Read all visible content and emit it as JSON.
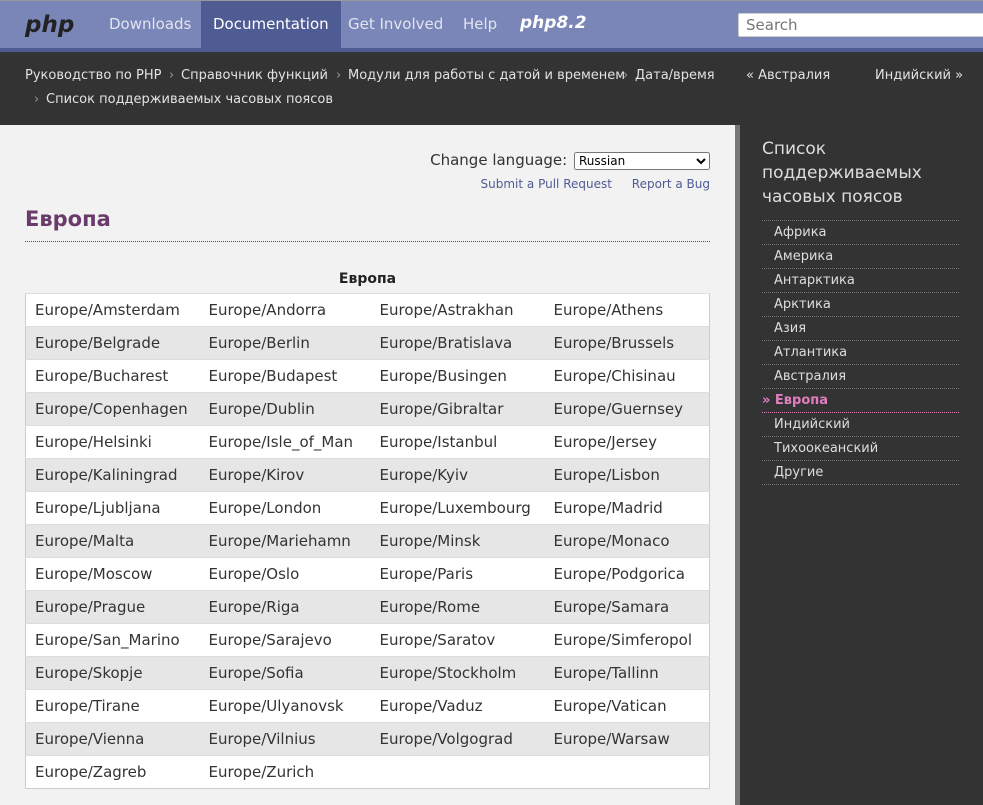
{
  "nav": {
    "logo": "php",
    "items": [
      "Downloads",
      "Documentation",
      "Get Involved",
      "Help"
    ],
    "active": "Documentation",
    "version_logo": "php8.2",
    "search_placeholder": "Search"
  },
  "breadcrumbs": [
    "Руководство по PHP",
    "Справочник функций",
    "Модули для работы с датой и временем",
    "Дата/время",
    "Список поддерживаемых часовых поясов"
  ],
  "prev_link": "« Австралия",
  "next_link": "Индийский »",
  "lang": {
    "label": "Change language:",
    "selected": "Russian"
  },
  "links": {
    "pull": "Submit a Pull Request",
    "bug": "Report a Bug"
  },
  "title": "Европа",
  "table": {
    "caption": "Европа",
    "rows": [
      [
        "Europe/Amsterdam",
        "Europe/Andorra",
        "Europe/Astrakhan",
        "Europe/Athens"
      ],
      [
        "Europe/Belgrade",
        "Europe/Berlin",
        "Europe/Bratislava",
        "Europe/Brussels"
      ],
      [
        "Europe/Bucharest",
        "Europe/Budapest",
        "Europe/Busingen",
        "Europe/Chisinau"
      ],
      [
        "Europe/Copenhagen",
        "Europe/Dublin",
        "Europe/Gibraltar",
        "Europe/Guernsey"
      ],
      [
        "Europe/Helsinki",
        "Europe/Isle_of_Man",
        "Europe/Istanbul",
        "Europe/Jersey"
      ],
      [
        "Europe/Kaliningrad",
        "Europe/Kirov",
        "Europe/Kyiv",
        "Europe/Lisbon"
      ],
      [
        "Europe/Ljubljana",
        "Europe/London",
        "Europe/Luxembourg",
        "Europe/Madrid"
      ],
      [
        "Europe/Malta",
        "Europe/Mariehamn",
        "Europe/Minsk",
        "Europe/Monaco"
      ],
      [
        "Europe/Moscow",
        "Europe/Oslo",
        "Europe/Paris",
        "Europe/Podgorica"
      ],
      [
        "Europe/Prague",
        "Europe/Riga",
        "Europe/Rome",
        "Europe/Samara"
      ],
      [
        "Europe/San_Marino",
        "Europe/Sarajevo",
        "Europe/Saratov",
        "Europe/Simferopol"
      ],
      [
        "Europe/Skopje",
        "Europe/Sofia",
        "Europe/Stockholm",
        "Europe/Tallinn"
      ],
      [
        "Europe/Tirane",
        "Europe/Ulyanovsk",
        "Europe/Vaduz",
        "Europe/Vatican"
      ],
      [
        "Europe/Vienna",
        "Europe/Vilnius",
        "Europe/Volgograd",
        "Europe/Warsaw"
      ],
      [
        "Europe/Zagreb",
        "Europe/Zurich",
        "",
        ""
      ]
    ]
  },
  "sidebar": {
    "title": "Список поддерживаемых часовых поясов",
    "items": [
      "Африка",
      "Америка",
      "Антарктика",
      "Арктика",
      "Азия",
      "Атлантика",
      "Австралия",
      "» Европа",
      "Индийский",
      "Тихоокеанский",
      "Другие"
    ],
    "current_index": 7
  },
  "colors": {
    "nav": "#7a86b8",
    "nav_active": "#4f5b93",
    "title": "#693a6a",
    "current": "#e07fc0"
  }
}
